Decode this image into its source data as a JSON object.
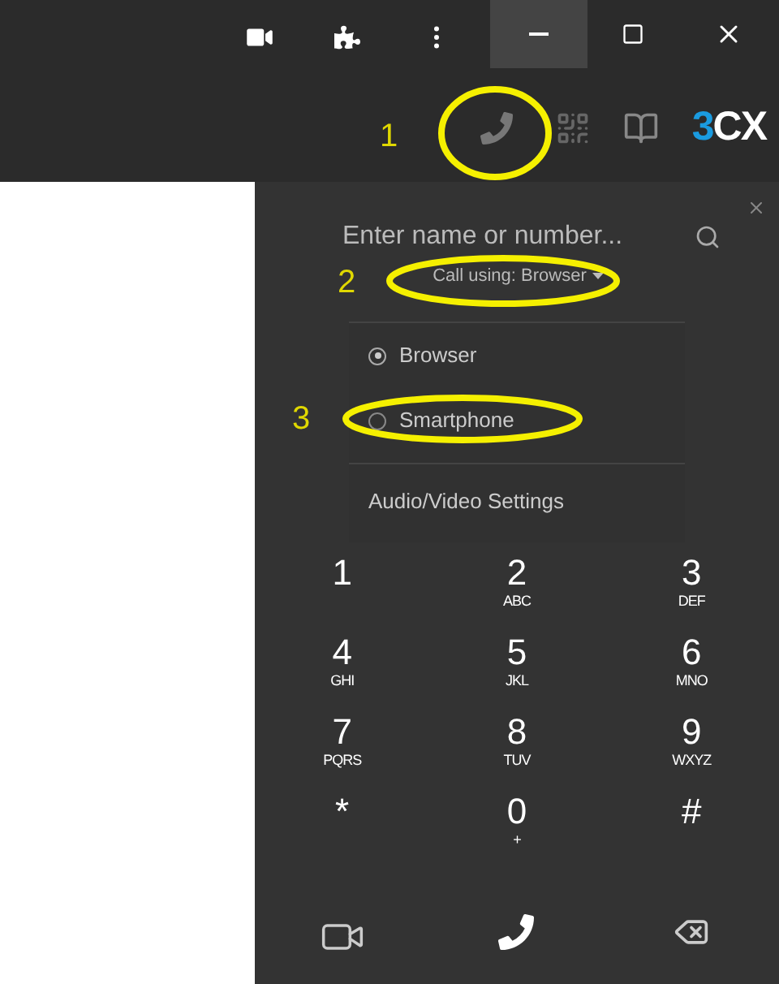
{
  "toolbar": {
    "phone_annotation": "1",
    "logo": {
      "accent": "3",
      "rest": "CX"
    }
  },
  "dialer": {
    "search": {
      "placeholder": "Enter name or number..."
    },
    "call_using": {
      "label": "Call using: Browser",
      "annotation": "2"
    },
    "menu": {
      "options": [
        {
          "label": "Browser",
          "selected": true
        },
        {
          "label": "Smartphone",
          "selected": false,
          "annotation": "3"
        }
      ],
      "settings": "Audio/Video Settings"
    },
    "keys": [
      {
        "digit": "1"
      },
      {
        "digit": "2",
        "letters": "ABC"
      },
      {
        "digit": "3",
        "letters": "DEF"
      },
      {
        "digit": "4",
        "letters": "GHI"
      },
      {
        "digit": "5",
        "letters": "JKL"
      },
      {
        "digit": "6",
        "letters": "MNO"
      },
      {
        "digit": "7",
        "letters": "PQRS"
      },
      {
        "digit": "8",
        "letters": "TUV"
      },
      {
        "digit": "9",
        "letters": "WXYZ"
      },
      {
        "digit": "*"
      },
      {
        "digit": "0",
        "letters": "+"
      },
      {
        "digit": "#"
      }
    ]
  }
}
